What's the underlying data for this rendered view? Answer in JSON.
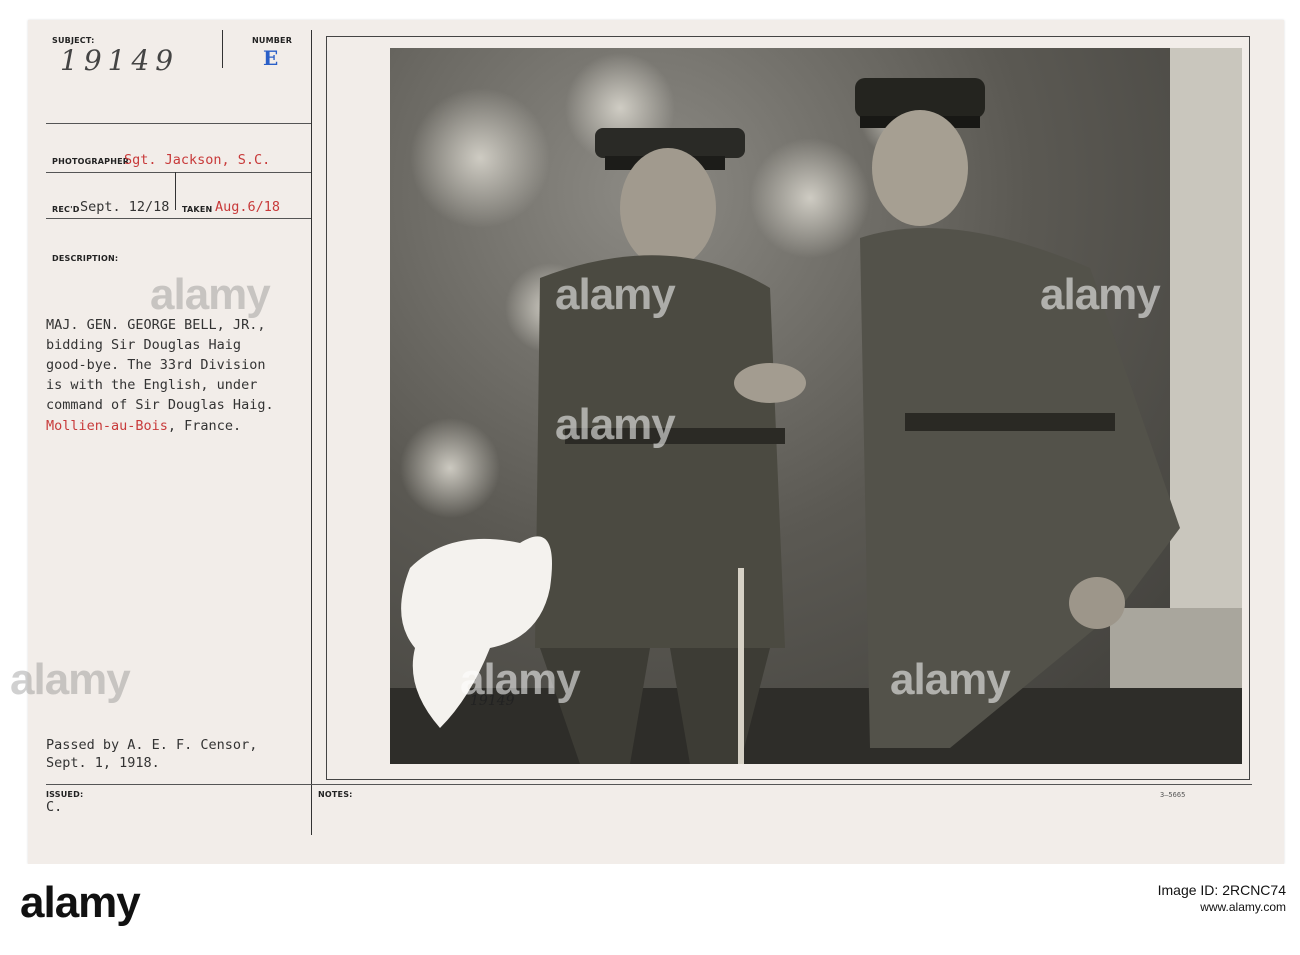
{
  "card": {
    "subject_label": "SUBJECT:",
    "subject_value": "19149",
    "number_label": "NUMBER",
    "number_value": "E",
    "photographer_label": "PHOTOGRAPHER",
    "photographer_value": "Sgt. Jackson, S.C.",
    "recd_label": "REC'D",
    "recd_value": "Sept. 12/18",
    "taken_label": "TAKEN",
    "taken_value": "Aug.6/18",
    "description_label": "DESCRIPTION:",
    "description_lines": [
      "MAJ. GEN. GEORGE BELL, JR.,",
      "bidding Sir Douglas Haig",
      "good-bye. The 33rd Division",
      "is with the English, under",
      "command of Sir Douglas Haig."
    ],
    "location_part1": "Mollien-au-Bois",
    "location_part2": ", France.",
    "censor_line1": "Passed by A. E. F. Censor,",
    "censor_line2": "Sept. 1, 1918.",
    "issued_label": "ISSUED:",
    "issued_value": "C.",
    "notes_label": "NOTES:",
    "ref_code": "3—5665",
    "photo_inscription": "19149"
  },
  "watermark": {
    "text": "alamy"
  },
  "footer": {
    "logo": "alamy",
    "image_id": "Image ID: 2RCNC74",
    "site": "www.alamy.com"
  },
  "colors": {
    "card_bg": "#f2ede9",
    "red_type": "#c83a3a",
    "blue_stamp": "#2a5fc8"
  }
}
